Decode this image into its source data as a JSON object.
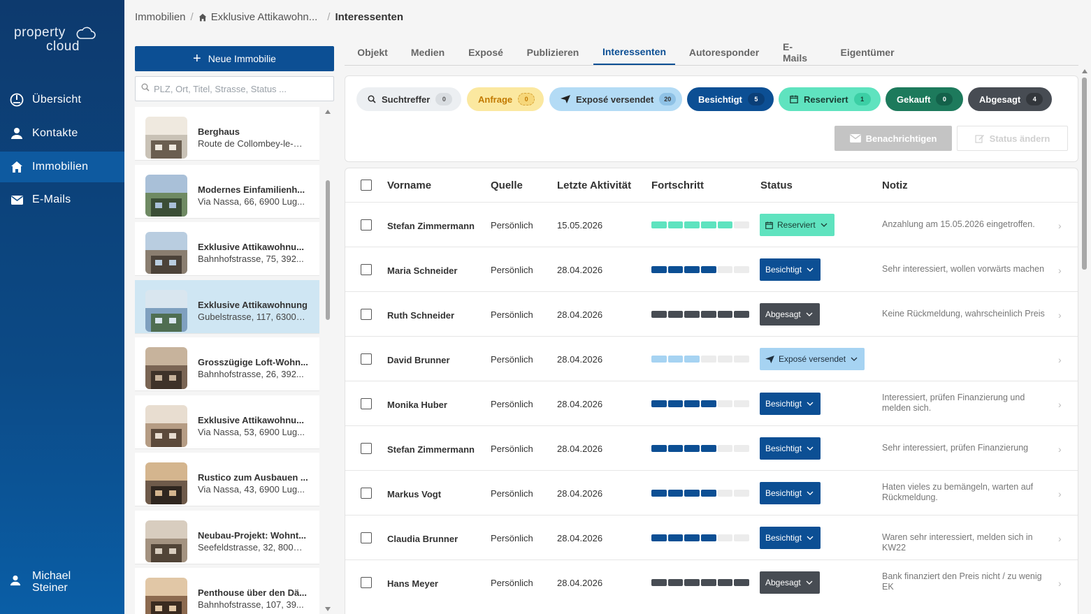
{
  "brand": {
    "line1": "property",
    "line2": "cloud"
  },
  "nav": {
    "items": [
      {
        "label": "Übersicht",
        "icon": "dashboard-icon"
      },
      {
        "label": "Kontakte",
        "icon": "person-icon"
      },
      {
        "label": "Immobilien",
        "icon": "home-icon",
        "active": true
      },
      {
        "label": "E-Mails",
        "icon": "mail-icon"
      }
    ],
    "user": {
      "first": "Michael",
      "last": "Steiner"
    }
  },
  "breadcrumb": {
    "root": "Immobilien",
    "property": "Exklusive Attikawohn...",
    "current": "Interessenten"
  },
  "sidebar": {
    "new_button": "Neue Immobilie",
    "search_placeholder": "PLZ, Ort, Titel, Strasse, Status ...",
    "properties": [
      {
        "title": "Berghaus",
        "address": "Route de Collombey-le-G..."
      },
      {
        "title": "Modernes Einfamilienh...",
        "address": "Via Nassa, 66, 6900 Lug..."
      },
      {
        "title": "Exklusive Attikawohnu...",
        "address": "Bahnhofstrasse, 75, 392..."
      },
      {
        "title": "Exklusive Attikawohnung",
        "address": "Gubelstrasse, 117, 6300 ...",
        "active": true
      },
      {
        "title": "Grosszügige Loft-Wohn...",
        "address": "Bahnhofstrasse, 26, 392..."
      },
      {
        "title": "Exklusive Attikawohnu...",
        "address": "Via Nassa, 53, 6900 Lug..."
      },
      {
        "title": "Rustico zum Ausbauen ...",
        "address": "Via Nassa, 43, 6900 Lug..."
      },
      {
        "title": "Neubau-Projekt: Wohnt...",
        "address": "Seefeldstrasse, 32, 8008 ..."
      },
      {
        "title": "Penthouse über den Dä...",
        "address": "Bahnhofstrasse, 107, 39..."
      }
    ]
  },
  "tabs": [
    "Objekt",
    "Medien",
    "Exposé",
    "Publizieren",
    "Interessenten",
    "Autoresponder",
    "E-Mails",
    "Eigentümer"
  ],
  "active_tab": "Interessenten",
  "filters": [
    {
      "label": "Suchtreffer",
      "count": "0"
    },
    {
      "label": "Anfrage",
      "count": "0"
    },
    {
      "label": "Exposé versendet",
      "count": "20"
    },
    {
      "label": "Besichtigt",
      "count": "5"
    },
    {
      "label": "Reserviert",
      "count": "1"
    },
    {
      "label": "Gekauft",
      "count": "0"
    },
    {
      "label": "Abgesagt",
      "count": "4"
    }
  ],
  "actions": {
    "notify": "Benachrichtigen",
    "change_status": "Status ändern"
  },
  "table": {
    "headers": {
      "firstname": "Vorname",
      "source": "Quelle",
      "last_activity": "Letzte Aktivität",
      "progress": "Fortschritt",
      "status": "Status",
      "note": "Notiz"
    },
    "rows": [
      {
        "name": "Stefan Zimmermann",
        "source": "Persönlich",
        "date": "15.05.2026",
        "progress": 5,
        "status": "Reserviert",
        "note": "Anzahlung am 15.05.2026 eingetroffen."
      },
      {
        "name": "Maria Schneider",
        "source": "Persönlich",
        "date": "28.04.2026",
        "progress": 4,
        "status": "Besichtigt",
        "note": "Sehr interessiert, wollen vorwärts machen"
      },
      {
        "name": "Ruth Schneider",
        "source": "Persönlich",
        "date": "28.04.2026",
        "progress": 6,
        "status": "Abgesagt",
        "note": "Keine Rückmeldung, wahrscheinlich Preis"
      },
      {
        "name": "David Brunner",
        "source": "Persönlich",
        "date": "28.04.2026",
        "progress": 3,
        "status": "Exposé versendet",
        "note": ""
      },
      {
        "name": "Monika Huber",
        "source": "Persönlich",
        "date": "28.04.2026",
        "progress": 4,
        "status": "Besichtigt",
        "note": "Interessiert, prüfen Finanzierung und melden sich."
      },
      {
        "name": "Stefan Zimmermann",
        "source": "Persönlich",
        "date": "28.04.2026",
        "progress": 4,
        "status": "Besichtigt",
        "note": "Sehr interessiert, prüfen Finanzierung"
      },
      {
        "name": "Markus Vogt",
        "source": "Persönlich",
        "date": "28.04.2026",
        "progress": 4,
        "status": "Besichtigt",
        "note": "Haten vieles zu bemängeln, warten auf Rückmeldung."
      },
      {
        "name": "Claudia Brunner",
        "source": "Persönlich",
        "date": "28.04.2026",
        "progress": 4,
        "status": "Besichtigt",
        "note": "Waren sehr interessiert, melden sich in KW22"
      },
      {
        "name": "Hans Meyer",
        "source": "Persönlich",
        "date": "28.04.2026",
        "progress": 6,
        "status": "Abgesagt",
        "note": "Bank finanziert den Preis nicht / zu wenig EK"
      }
    ]
  },
  "colors": {
    "primary": "#0c4f94",
    "reserviert": "#5fe3bf",
    "besichtigt": "#0c4f94",
    "abgesagt": "#474c53",
    "expose": "#a6d3f2",
    "anfrage": "#fbe8a0",
    "gekauft": "#1d7a5c"
  }
}
